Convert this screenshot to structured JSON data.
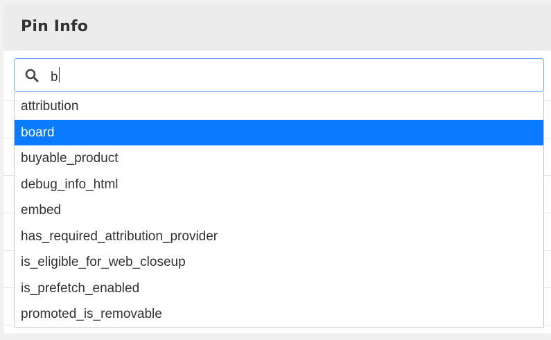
{
  "panel": {
    "title": "Pin Info"
  },
  "search": {
    "value": "b",
    "icon": "search-icon"
  },
  "dropdown": {
    "selected_index": 1,
    "options": [
      "attribution",
      "board",
      "buyable_product",
      "debug_info_html",
      "embed",
      "has_required_attribution_provider",
      "is_eligible_for_web_closeup",
      "is_prefetch_enabled",
      "promoted_is_removable"
    ]
  },
  "colors": {
    "highlight": "#0a7bff",
    "focus_border": "#6ea8fe",
    "header_bg": "#ececec"
  }
}
